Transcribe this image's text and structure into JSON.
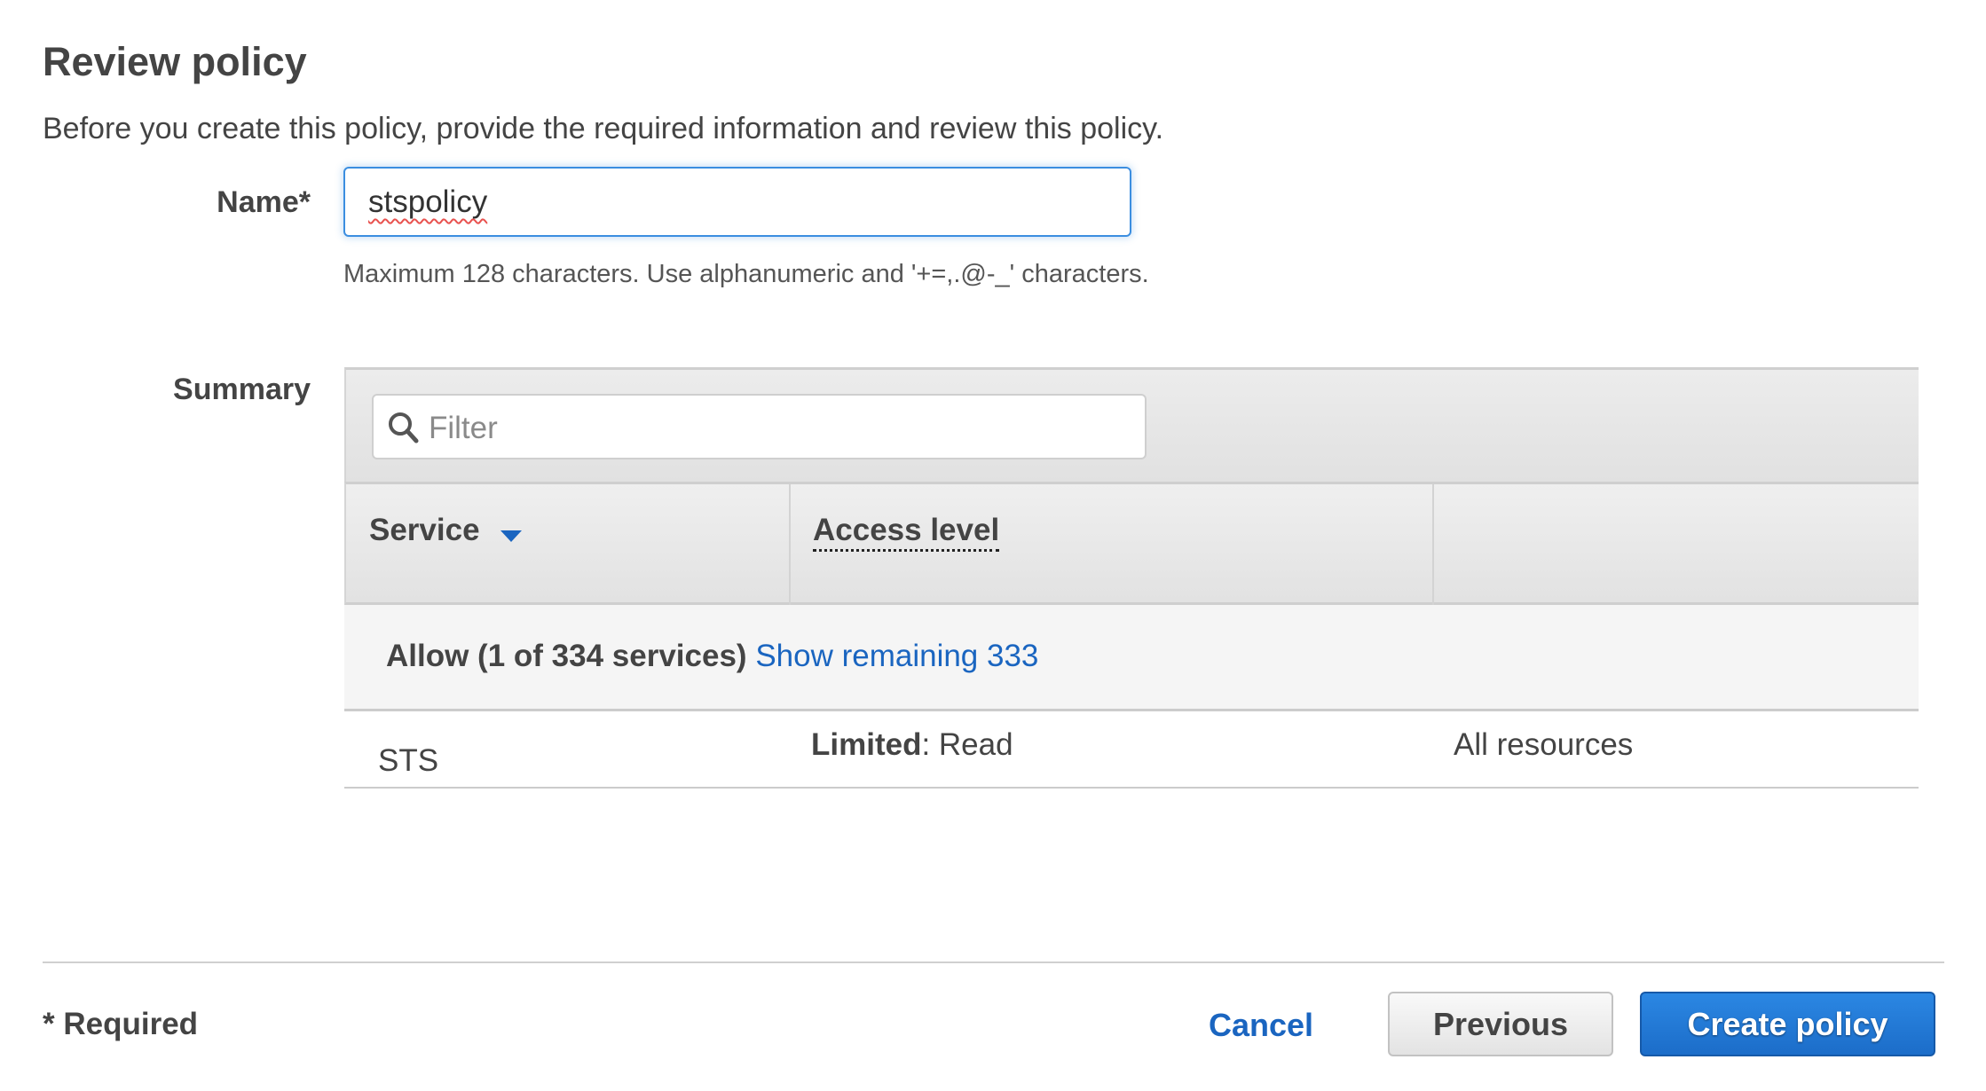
{
  "page": {
    "title": "Review policy",
    "description": "Before you create this policy, provide the required information and review this policy."
  },
  "name_field": {
    "label": "Name*",
    "value": "stspolicy",
    "hint": "Maximum 128 characters. Use alphanumeric and '+=,.@-_' characters."
  },
  "summary": {
    "label": "Summary",
    "filter": {
      "placeholder": "Filter",
      "icon": "search-icon"
    },
    "columns": [
      {
        "label": "Service",
        "sort": "descending"
      },
      {
        "label": "Access level"
      },
      {
        "label": ""
      }
    ],
    "group": {
      "label": "Allow (1 of 334 services)",
      "link": "Show remaining 333"
    },
    "rows": [
      {
        "service": "STS",
        "access_level_bold": "Limited",
        "access_level_rest": ": Read",
        "resource": "All resources"
      }
    ]
  },
  "footer": {
    "required_note": "* Required",
    "cancel_label": "Cancel",
    "previous_label": "Previous",
    "create_label": "Create policy"
  },
  "colors": {
    "link": "#1a65c0",
    "primary_button": "#1f74d0",
    "focus_border": "#3b8ee0"
  }
}
